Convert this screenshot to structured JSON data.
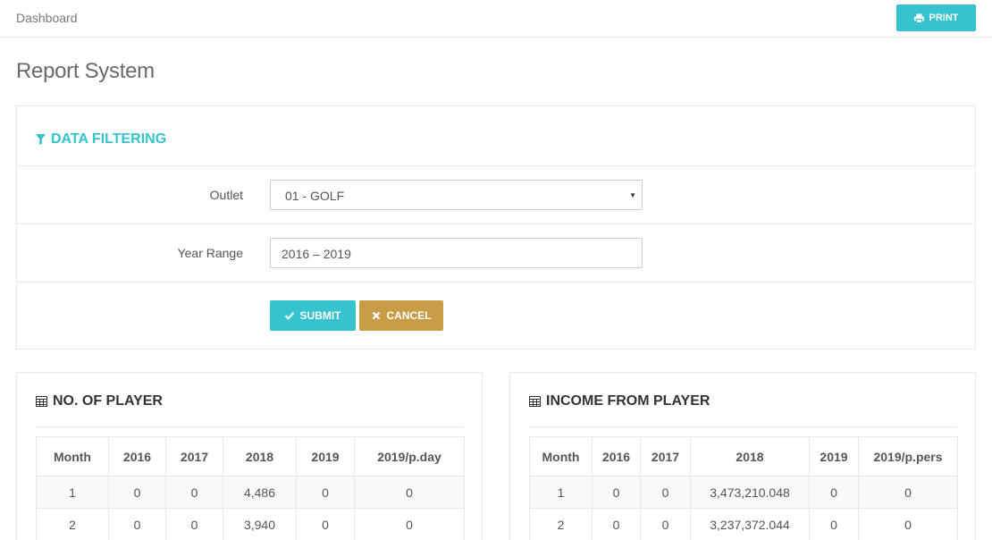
{
  "breadcrumb": "Dashboard",
  "print_label": "PRINT",
  "page_title": "Report System",
  "filter": {
    "title": "DATA FILTERING",
    "outlet_label": "Outlet",
    "outlet_value": "01 - GOLF",
    "year_range_label": "Year Range",
    "year_range_value": "2016 – 2019",
    "submit_label": "SUBMIT",
    "cancel_label": "CANCEL"
  },
  "players_table": {
    "title": "NO. OF PLAYER",
    "columns": [
      "Month",
      "2016",
      "2017",
      "2018",
      "2019",
      "2019/p.day"
    ],
    "rows": [
      [
        "1",
        "0",
        "0",
        "4,486",
        "0",
        "0"
      ],
      [
        "2",
        "0",
        "0",
        "3,940",
        "0",
        "0"
      ]
    ]
  },
  "income_table": {
    "title": "INCOME FROM PLAYER",
    "columns": [
      "Month",
      "2016",
      "2017",
      "2018",
      "2019",
      "2019/p.pers"
    ],
    "rows": [
      [
        "1",
        "0",
        "0",
        "3,473,210.048",
        "0",
        "0"
      ],
      [
        "2",
        "0",
        "0",
        "3,237,372.044",
        "0",
        "0"
      ]
    ]
  },
  "colors": {
    "accent": "#36c2cf",
    "cancel": "#c89b45"
  },
  "icons": {
    "print": "print-icon",
    "filter": "filter-icon",
    "submit": "check-icon",
    "cancel": "close-icon",
    "table": "table-icon"
  }
}
